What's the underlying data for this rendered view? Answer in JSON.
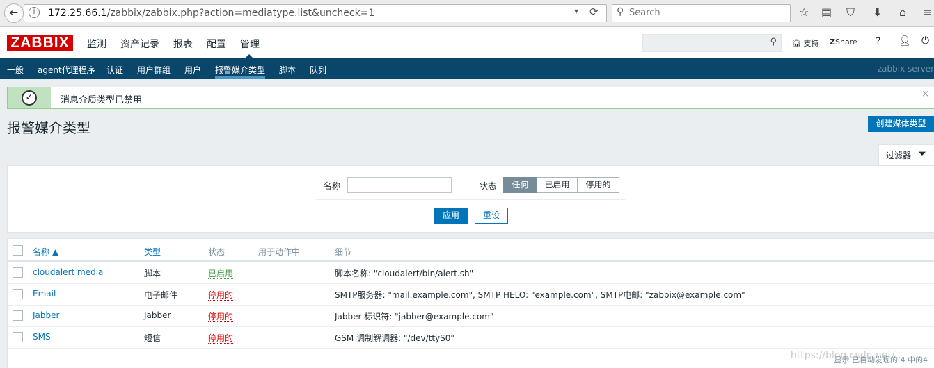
{
  "browser": {
    "url_host": "172.25.66.1",
    "url_path": "/zabbix/zabbix.php?action=mediatype.list&uncheck=1",
    "search_placeholder": "Search"
  },
  "header": {
    "logo": "ZABBIX",
    "menu": [
      "监测",
      "资产记录",
      "报表",
      "配置",
      "管理"
    ],
    "support": "支持",
    "share": "Share",
    "help": "?"
  },
  "submenu": {
    "items": [
      "一般",
      "agent代理程序",
      "认证",
      "用户群组",
      "用户",
      "报警媒介类型",
      "脚本",
      "队列"
    ],
    "server": "zabbix server"
  },
  "message": {
    "text": "消息介质类型已禁用",
    "close": "×"
  },
  "page": {
    "title": "报警媒介类型",
    "create_button": "创建媒体类型"
  },
  "filter": {
    "tab_label": "过滤器",
    "name_label": "名称",
    "name_value": "",
    "status_label": "状态",
    "status_options": [
      "任何",
      "已启用",
      "停用的"
    ],
    "status_selected": "任何",
    "apply": "应用",
    "reset": "重设"
  },
  "table": {
    "headers": [
      "名称 ▲",
      "类型",
      "状态",
      "用于动作中",
      "细节"
    ],
    "rows": [
      {
        "name": "cloudalert media",
        "type": "脚本",
        "status": "已启用",
        "used": "",
        "details": "脚本名称: \"cloudalert/bin/alert.sh\""
      },
      {
        "name": "Email",
        "type": "电子邮件",
        "status": "停用的",
        "used": "",
        "details": "SMTP服务器: \"mail.example.com\", SMTP HELO: \"example.com\", SMTP电邮: \"zabbix@example.com\""
      },
      {
        "name": "Jabber",
        "type": "Jabber",
        "status": "停用的",
        "used": "",
        "details": "Jabber 标识符: \"jabber@example.com\""
      },
      {
        "name": "SMS",
        "type": "短信",
        "status": "停用的",
        "used": "",
        "details": "GSM 调制解调器: \"/dev/ttyS0\""
      }
    ],
    "paging": "显示 已自动发现的 4 中的4"
  },
  "watermark": "https://blog.csdn.net/..."
}
